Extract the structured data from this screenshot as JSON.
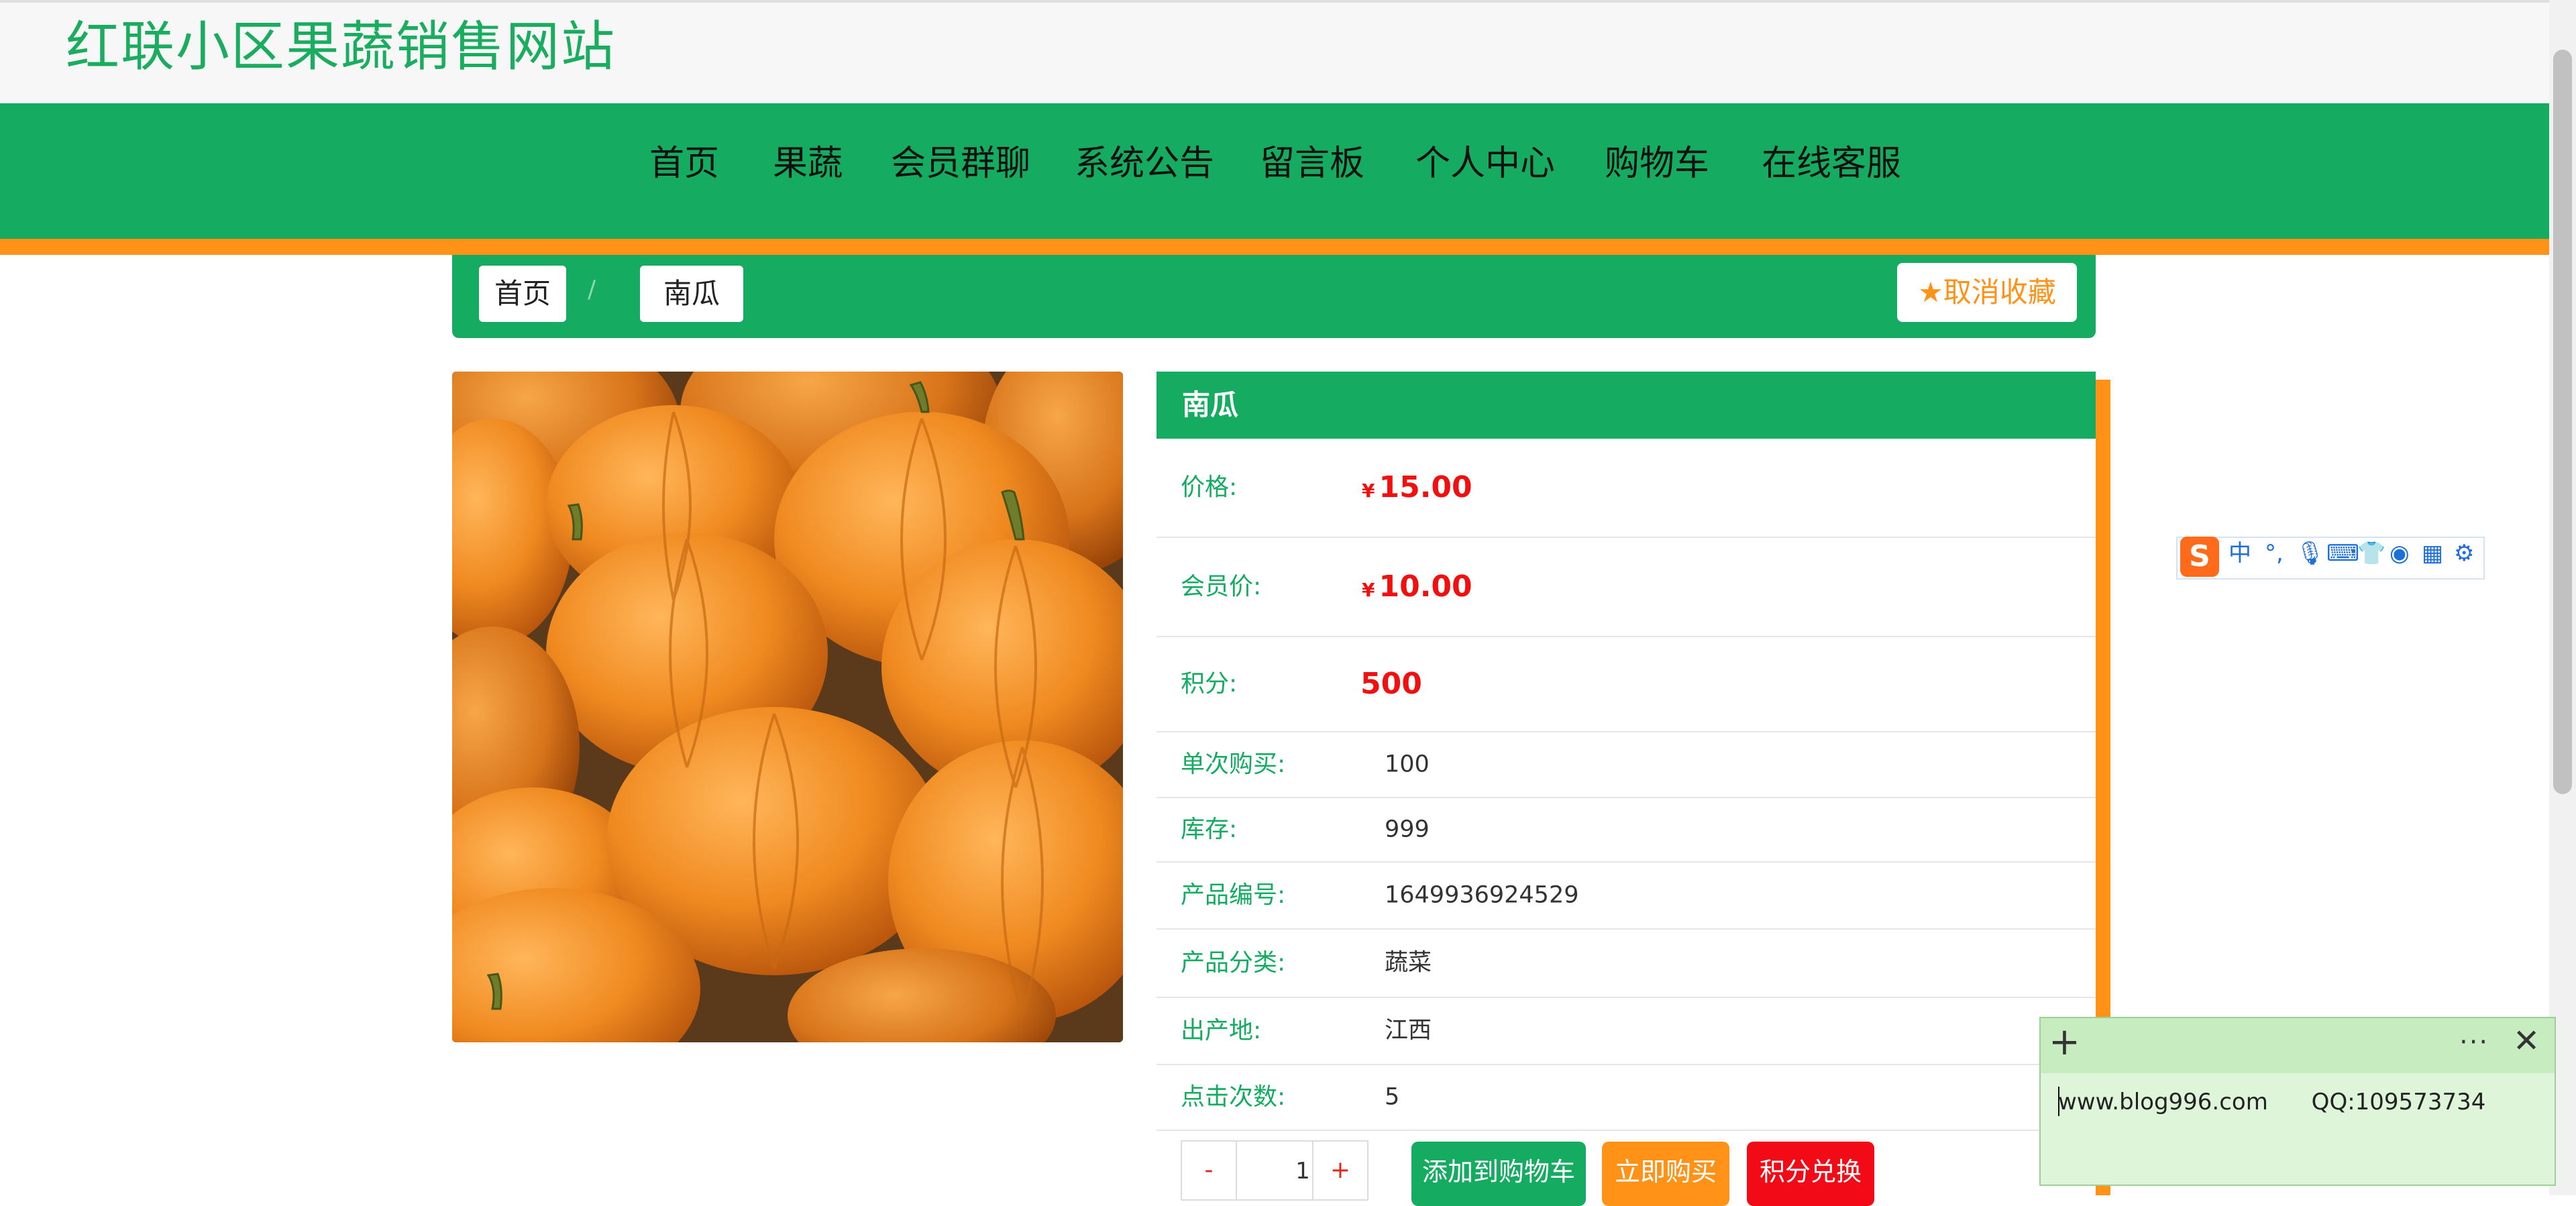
{
  "site": {
    "title": "红联小区果蔬销售网站"
  },
  "nav": {
    "items": [
      {
        "label": "首页"
      },
      {
        "label": "果蔬"
      },
      {
        "label": "会员群聊"
      },
      {
        "label": "系统公告"
      },
      {
        "label": "留言板"
      },
      {
        "label": "个人中心"
      },
      {
        "label": "购物车"
      },
      {
        "label": "在线客服"
      }
    ]
  },
  "breadcrumb": {
    "home": "首页",
    "separator": "/",
    "current": "南瓜"
  },
  "favorite": {
    "icon": "star-icon",
    "label": "取消收藏",
    "color": "#ff9217"
  },
  "product": {
    "name": "南瓜",
    "image": "pumpkin-photo",
    "currency": "¥",
    "price_label": "价格:",
    "price": "15.00",
    "member_price_label": "会员价:",
    "member_price": "10.00",
    "points_label": "积分:",
    "points": "500",
    "single_buy_label": "单次购买:",
    "single_buy": "100",
    "stock_label": "库存:",
    "stock": "999",
    "code_label": "产品编号:",
    "code": "1649936924529",
    "category_label": "产品分类:",
    "category": "蔬菜",
    "origin_label": "出产地:",
    "origin": "江西",
    "clicks_label": "点击次数:",
    "clicks": "5"
  },
  "quantity": {
    "minus": "-",
    "value": "1",
    "plus": "+"
  },
  "actions": {
    "add_to_cart": "添加到购物车",
    "buy_now": "立即购买",
    "redeem_points": "积分兑换"
  },
  "colors": {
    "primary": "#15ac62",
    "accent": "#ff9217",
    "price": "#f01010",
    "redeem": "#f20a16"
  },
  "ime": {
    "logo": "S",
    "mode": "中",
    "punct": "°,",
    "icons": [
      "microphone-icon",
      "keyboard-icon",
      "skin-icon",
      "robot-icon",
      "grid-icon",
      "settings-icon"
    ]
  },
  "note": {
    "text": "www.blog996.com      QQ:109573734",
    "plus": "+",
    "more": "···",
    "close": "✕"
  }
}
